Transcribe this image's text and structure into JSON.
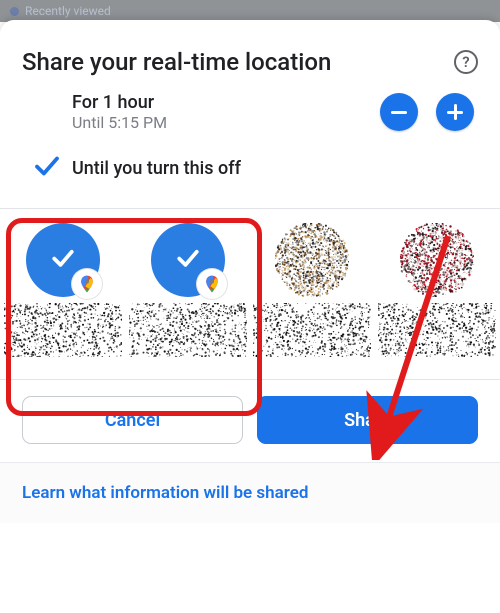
{
  "topbar": {
    "recently_viewed": "Recently viewed"
  },
  "header": {
    "title": "Share your real-time location",
    "help_glyph": "?"
  },
  "duration_option": {
    "title": "For 1 hour",
    "subtitle": "Until 5:15 PM"
  },
  "until_off_option": {
    "label": "Until you turn this off"
  },
  "contacts": [
    {
      "selected": true,
      "has_maps_badge": true
    },
    {
      "selected": true,
      "has_maps_badge": true
    },
    {
      "selected": false,
      "has_maps_badge": false
    },
    {
      "selected": false,
      "has_maps_badge": false
    }
  ],
  "buttons": {
    "cancel": "Cancel",
    "share": "Share"
  },
  "footer": {
    "learn": "Learn what information will be shared"
  },
  "colors": {
    "accent": "#1a73e8",
    "annotation_red": "#e11b1b"
  }
}
